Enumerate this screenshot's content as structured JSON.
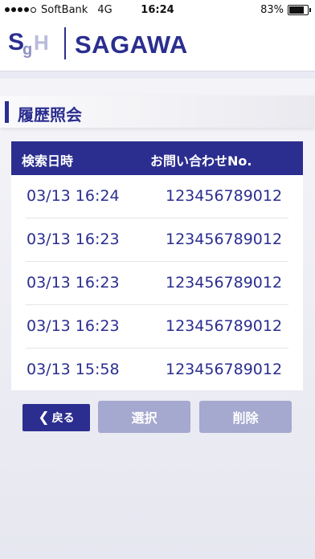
{
  "status_bar": {
    "carrier": "SoftBank",
    "network": "4G",
    "time": "16:24",
    "battery": "83%",
    "battery_level": 0.83
  },
  "header": {
    "logo_mark": "SgH",
    "brand": "SAGAWA"
  },
  "section": {
    "title": "履歴照会"
  },
  "table": {
    "headers": [
      "検索日時",
      "お問い合わせNo."
    ],
    "rows": [
      {
        "datetime": "03/13  16:24",
        "number": "123456789012"
      },
      {
        "datetime": "03/13  16:23",
        "number": "123456789012"
      },
      {
        "datetime": "03/13  16:23",
        "number": "123456789012"
      },
      {
        "datetime": "03/13  16:23",
        "number": "123456789012"
      },
      {
        "datetime": "03/13  15:58",
        "number": "123456789012"
      }
    ]
  },
  "buttons": {
    "back_label": "戻る",
    "select_label": "選択",
    "delete_label": "削除"
  },
  "colors": {
    "brand": "#2b2e8f",
    "disabled_button": "#a5a8cf"
  }
}
